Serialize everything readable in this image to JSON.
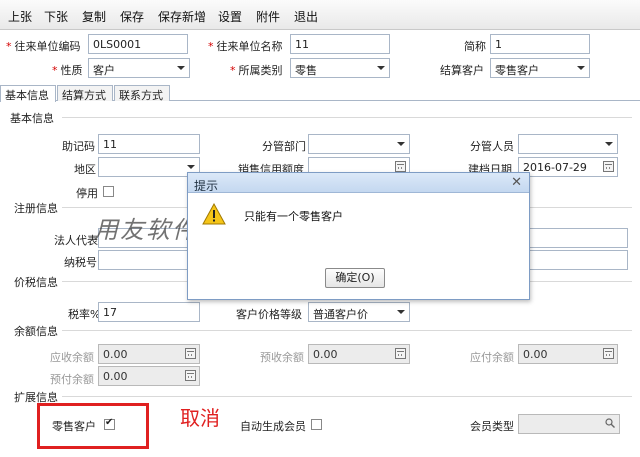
{
  "toolbar": {
    "items": [
      "上张",
      "下张",
      "复制",
      "保存",
      "保存新增",
      "设置",
      "附件",
      "退出"
    ]
  },
  "header": {
    "code_label": "往来单位编码",
    "code_value": "0LS0001",
    "name_label": "往来单位名称",
    "name_value": "11",
    "short_label": "简称",
    "short_value": "1",
    "nature_label": "性质",
    "nature_value": "客户",
    "category_label": "所属类别",
    "category_value": "零售",
    "settle_label": "结算客户",
    "settle_value": "零售客户"
  },
  "tabs": [
    "基本信息",
    "结算方式",
    "联系方式"
  ],
  "basic": {
    "section_title": "基本信息",
    "helpcode_label": "助记码",
    "helpcode_value": "11",
    "dept_label": "分管部门",
    "staff_label": "分管人员",
    "region_label": "地区",
    "credit_label": "销售信用额度",
    "created_label": "建档日期",
    "created_value": "2016-07-29",
    "disabled_label": "停用"
  },
  "register": {
    "section_title": "注册信息",
    "legal_label": "法人代表",
    "tax_label": "纳税号"
  },
  "pricetax": {
    "section_title": "价税信息",
    "taxrate_label": "税率%",
    "taxrate_value": "17",
    "pricelevel_label": "客户价格等级",
    "pricelevel_value": "普通客户价"
  },
  "balance": {
    "section_title": "余额信息",
    "receivable_label": "应收余额",
    "receivable_value": "0.00",
    "prereceived_label": "预收余额",
    "prereceived_value": "0.00",
    "payable_label": "应付余额",
    "payable_value": "0.00",
    "prepaid_label": "预付余额",
    "prepaid_value": "0.00"
  },
  "extend": {
    "section_title": "扩展信息",
    "retail_label": "零售客户",
    "retail_checked": true,
    "automember_label": "自动生成会员",
    "membertype_label": "会员类型"
  },
  "dialog": {
    "title": "提示",
    "message": "只能有一个零售客户",
    "ok_label": "确定(O)"
  },
  "overlay": {
    "watermark": "用友软件下载: ufidawhy.com",
    "note": "取消"
  },
  "colors": {
    "required": "#d40000",
    "annotation": "#e02020",
    "dialog_border": "#7e9cc4"
  }
}
